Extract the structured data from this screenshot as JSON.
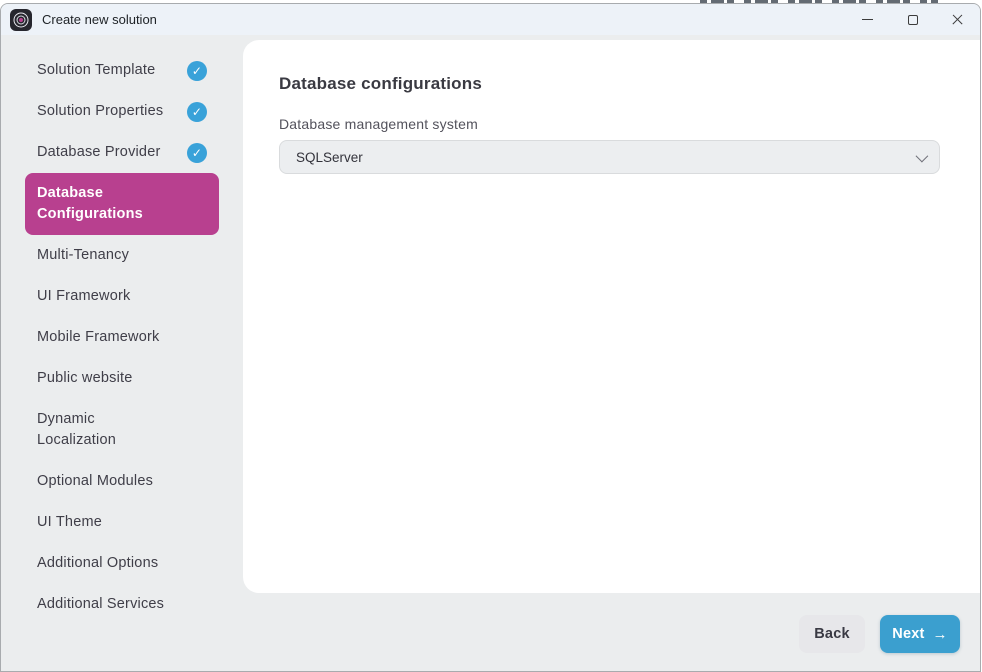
{
  "window": {
    "title": "Create new solution",
    "controls": {
      "minimize": "minimize",
      "maximize": "maximize",
      "close": "close"
    }
  },
  "sidebar": {
    "items": [
      {
        "label": "Solution Template",
        "completed": true
      },
      {
        "label": "Solution Properties",
        "completed": true
      },
      {
        "label": "Database Provider",
        "completed": true
      },
      {
        "label": "Database Configurations",
        "active": true,
        "two_line": true
      },
      {
        "label": "Multi-Tenancy"
      },
      {
        "label": "UI Framework"
      },
      {
        "label": "Mobile Framework"
      },
      {
        "label": "Public website"
      },
      {
        "label": "Dynamic Localization",
        "two_line": true
      },
      {
        "label": "Optional Modules"
      },
      {
        "label": "UI Theme"
      },
      {
        "label": "Additional Options"
      },
      {
        "label": "Additional Services"
      }
    ]
  },
  "main": {
    "heading": "Database configurations",
    "field_label": "Database management system",
    "select_value": "SQLServer"
  },
  "footer": {
    "back_label": "Back",
    "next_label": "Next"
  },
  "icons": {
    "check": "✓",
    "next_arrow": "→"
  },
  "colors": {
    "accent_magenta": "#b8408f",
    "check_blue": "#39a2d9",
    "next_blue": "#3b9fcf",
    "titlebar_bg": "#edf2f8",
    "sidebar_bg": "#ebedee",
    "card_bg": "#ffffff"
  }
}
